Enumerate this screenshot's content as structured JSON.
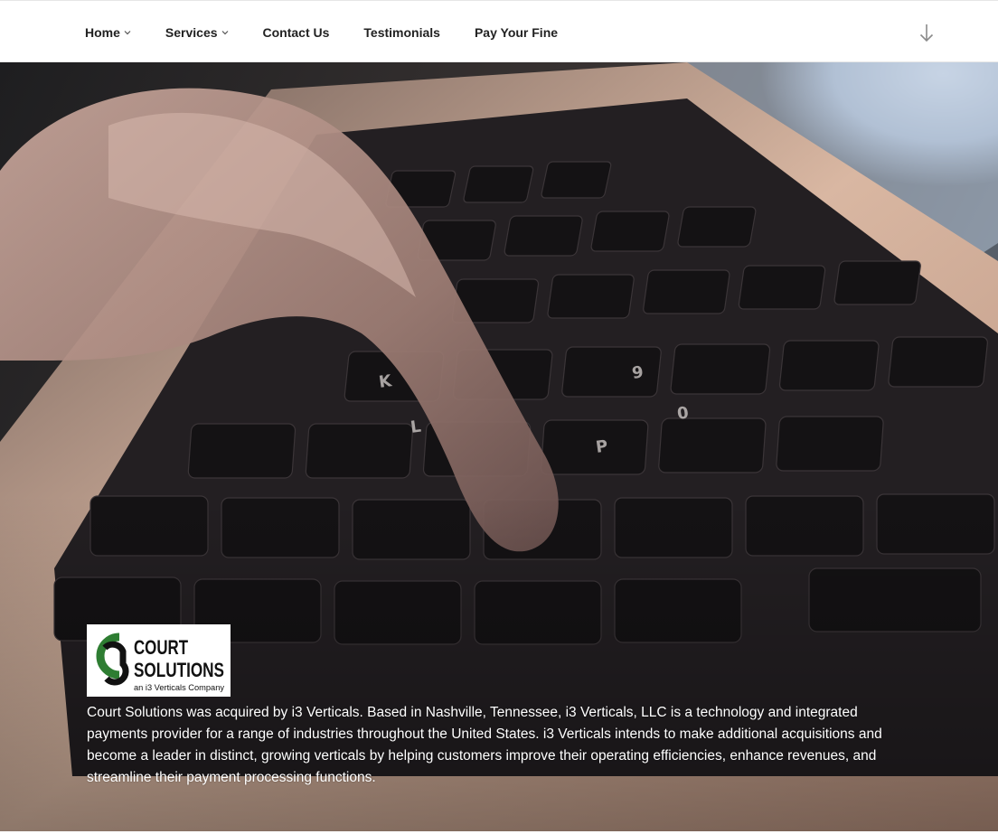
{
  "nav": {
    "items": [
      {
        "label": "Home",
        "has_dropdown": true
      },
      {
        "label": "Services",
        "has_dropdown": true
      },
      {
        "label": "Contact Us",
        "has_dropdown": false
      },
      {
        "label": "Testimonials",
        "has_dropdown": false
      },
      {
        "label": "Pay Your Fine",
        "has_dropdown": false
      }
    ],
    "scroll_icon": "arrow-down-icon"
  },
  "hero": {
    "image": "laptop-keyboard-typing-photo",
    "logo": {
      "name": "COURT SOLUTIONS",
      "line1": "COURT",
      "line2": "SOLUTIONS",
      "tagline": "an i3 Verticals Company",
      "colors": {
        "green": "#2e7d32",
        "black": "#111111"
      }
    },
    "description": "Court Solutions was acquired by i3 Verticals. Based in Nashville, Tennessee, i3 Verticals, LLC is a technology and integrated payments provider for a range of industries throughout the United States. i3 Verticals intends to make additional acquisitions and become a leader in distinct, growing verticals by helping customers improve their operating efficiencies, enhance revenues, and streamline their payment processing functions."
  },
  "colors": {
    "nav_text": "#222222",
    "topbar_bg": "#ffffff",
    "hero_text": "#ffffff"
  }
}
